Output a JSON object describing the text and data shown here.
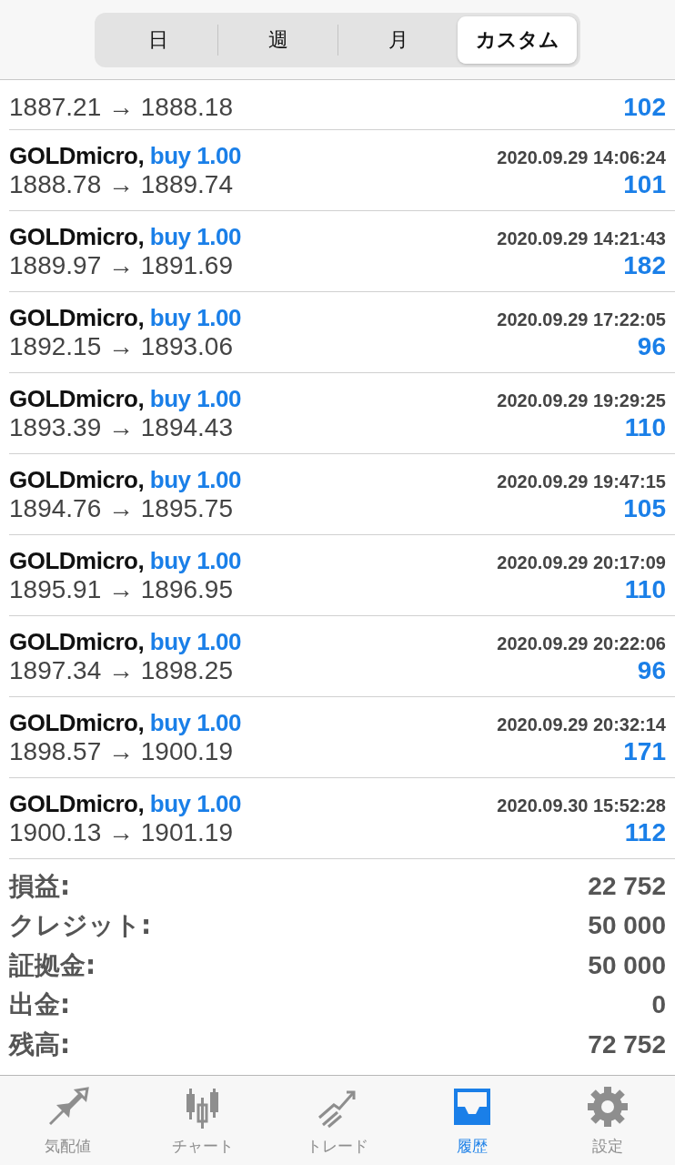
{
  "segments": [
    {
      "label": "日",
      "selected": false
    },
    {
      "label": "週",
      "selected": false
    },
    {
      "label": "月",
      "selected": false
    },
    {
      "label": "カスタム",
      "selected": true
    }
  ],
  "deals": [
    {
      "kind": "partial",
      "prices": "1887.21 → 1888.18",
      "profit": "102"
    },
    {
      "symbol": "GOLDmicro,",
      "side": "buy 1.00",
      "time": "2020.09.29 14:06:24",
      "prices": "1888.78 → 1889.74",
      "profit": "101"
    },
    {
      "symbol": "GOLDmicro,",
      "side": "buy 1.00",
      "time": "2020.09.29 14:21:43",
      "prices": "1889.97 → 1891.69",
      "profit": "182"
    },
    {
      "symbol": "GOLDmicro,",
      "side": "buy 1.00",
      "time": "2020.09.29 17:22:05",
      "prices": "1892.15 → 1893.06",
      "profit": "96"
    },
    {
      "symbol": "GOLDmicro,",
      "side": "buy 1.00",
      "time": "2020.09.29 19:29:25",
      "prices": "1893.39 → 1894.43",
      "profit": "110"
    },
    {
      "symbol": "GOLDmicro,",
      "side": "buy 1.00",
      "time": "2020.09.29 19:47:15",
      "prices": "1894.76 → 1895.75",
      "profit": "105"
    },
    {
      "symbol": "GOLDmicro,",
      "side": "buy 1.00",
      "time": "2020.09.29 20:17:09",
      "prices": "1895.91 → 1896.95",
      "profit": "110"
    },
    {
      "symbol": "GOLDmicro,",
      "side": "buy 1.00",
      "time": "2020.09.29 20:22:06",
      "prices": "1897.34 → 1898.25",
      "profit": "96"
    },
    {
      "symbol": "GOLDmicro,",
      "side": "buy 1.00",
      "time": "2020.09.29 20:32:14",
      "prices": "1898.57 → 1900.19",
      "profit": "171"
    },
    {
      "symbol": "GOLDmicro,",
      "side": "buy 1.00",
      "time": "2020.09.30 15:52:28",
      "prices": "1900.13 → 1901.19",
      "profit": "112"
    }
  ],
  "summary": [
    {
      "label": "損益:",
      "value": "22 752"
    },
    {
      "label": "クレジット:",
      "value": "50 000"
    },
    {
      "label": "証拠金:",
      "value": "50 000"
    },
    {
      "label": "出金:",
      "value": "0"
    },
    {
      "label": "残高:",
      "value": "72 752"
    }
  ],
  "tab_bar": [
    {
      "kind": "quotes",
      "label": "気配値",
      "selected": false
    },
    {
      "kind": "chart",
      "label": "チャート",
      "selected": false
    },
    {
      "kind": "trade",
      "label": "トレード",
      "selected": false
    },
    {
      "kind": "history",
      "label": "履歴",
      "selected": true
    },
    {
      "kind": "settings",
      "label": "設定",
      "selected": false
    }
  ]
}
